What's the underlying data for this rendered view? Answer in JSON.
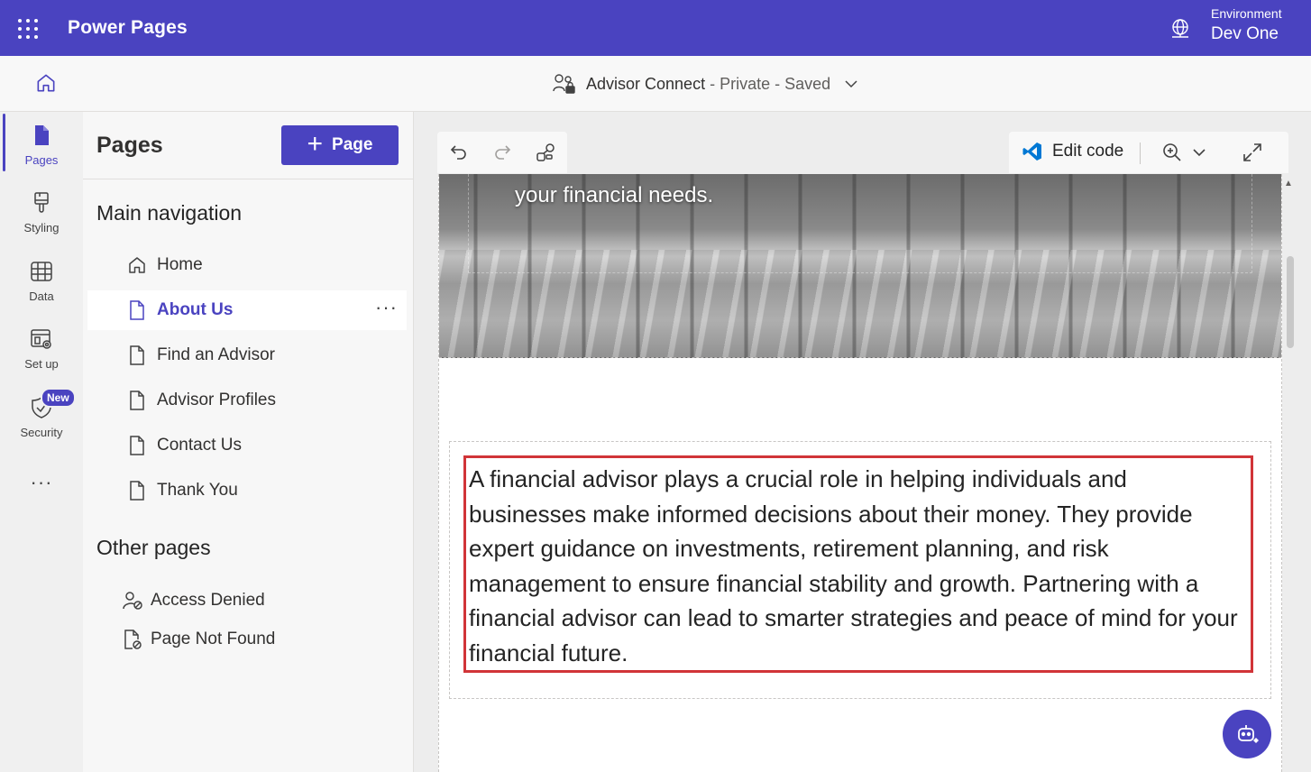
{
  "app": {
    "title": "Power Pages",
    "environment_label": "Environment",
    "environment_value": "Dev One"
  },
  "site": {
    "name": "Advisor Connect",
    "visibility": "Private",
    "status": "Saved",
    "separator": " - "
  },
  "rail": {
    "items": [
      {
        "label": "Pages",
        "icon": "page-icon",
        "active": true
      },
      {
        "label": "Styling",
        "icon": "paintbrush-icon",
        "active": false
      },
      {
        "label": "Data",
        "icon": "table-icon",
        "active": false
      },
      {
        "label": "Set up",
        "icon": "settings-window-icon",
        "active": false
      },
      {
        "label": "Security",
        "icon": "shield-check-icon",
        "active": false
      }
    ],
    "new_badge": "New",
    "more": "···"
  },
  "panel": {
    "title": "Pages",
    "add_button": "Page",
    "main_nav_heading": "Main navigation",
    "main_nav": [
      {
        "label": "Home",
        "icon": "home-icon"
      },
      {
        "label": "About Us",
        "icon": "page-icon",
        "active": true
      },
      {
        "label": "Find an Advisor",
        "icon": "page-icon"
      },
      {
        "label": "Advisor Profiles",
        "icon": "page-icon"
      },
      {
        "label": "Contact Us",
        "icon": "page-icon"
      },
      {
        "label": "Thank You",
        "icon": "page-icon"
      }
    ],
    "item_more": "···",
    "other_heading": "Other pages",
    "other_pages": [
      {
        "label": "Access Denied",
        "icon": "person-lock-icon"
      },
      {
        "label": "Page Not Found",
        "icon": "page-blocked-icon"
      }
    ]
  },
  "toolbar": {
    "edit_code": "Edit code"
  },
  "canvas": {
    "hero_text": "your financial needs.",
    "body_text": "A financial advisor plays a crucial role in helping individuals and businesses make informed decisions about their money. They provide expert guidance on investments, retirement planning, and risk management to ensure financial stability and growth. Partnering with a financial advisor can lead to smarter strategies and peace of mind for your financial future."
  },
  "colors": {
    "brand": "#4a43c0",
    "selection_border": "#d13438"
  }
}
